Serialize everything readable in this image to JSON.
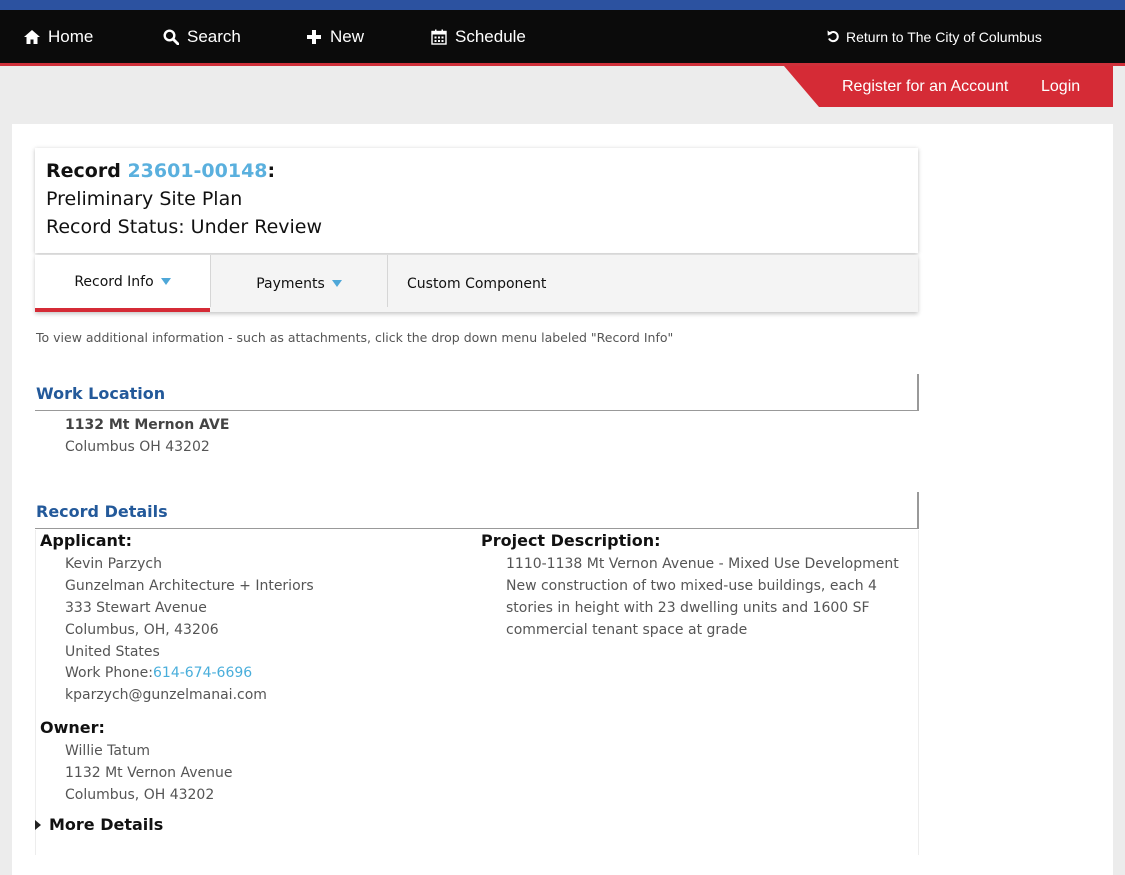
{
  "nav": {
    "home": "Home",
    "search": "Search",
    "new": "New",
    "schedule": "Schedule",
    "return": "Return to The City of Columbus"
  },
  "account": {
    "register": "Register for an Account",
    "login": "Login"
  },
  "record": {
    "label": "Record",
    "number": "23601-00148",
    "colon": ":",
    "type": "Preliminary Site Plan",
    "status": "Record Status: Under Review"
  },
  "tabs": {
    "record_info": "Record Info",
    "payments": "Payments",
    "custom": "Custom Component"
  },
  "hint": "To view additional information - such as attachments, click the drop down menu labeled \"Record Info\"",
  "work_location": {
    "heading": "Work Location",
    "street": "1132 Mt Mernon AVE",
    "city": "Columbus OH 43202"
  },
  "record_details": {
    "heading": "Record Details",
    "applicant": {
      "label": "Applicant:",
      "name": "Kevin Parzych",
      "company": "Gunzelman Architecture + Interiors",
      "address": "333 Stewart Avenue",
      "city": "Columbus, OH, 43206",
      "country": "United States",
      "phone_label": "Work Phone:",
      "phone": "614-674-6696",
      "email": "kparzych@gunzelmanai.com"
    },
    "owner": {
      "label": "Owner:",
      "name": "Willie Tatum",
      "address": "1132 Mt Vernon Avenue",
      "city": "Columbus, OH 43202"
    },
    "project": {
      "label": "Project Description:",
      "line1": "1110-1138 Mt Vernon Avenue - Mixed Use Development",
      "line2": "New construction of two mixed-use buildings, each 4 stories in height with 23 dwelling units and 1600 SF commercial tenant space at grade"
    },
    "more_details": "More Details"
  },
  "colors": {
    "nav_bg": "#0b0b0b",
    "top_stripe": "#2c52a0",
    "accent_red": "#d52b36",
    "link_blue": "#5ab0de",
    "heading_blue": "#23599a"
  },
  "icons": [
    "home-icon",
    "search-icon",
    "plus-icon",
    "calendar-icon",
    "return-icon"
  ]
}
